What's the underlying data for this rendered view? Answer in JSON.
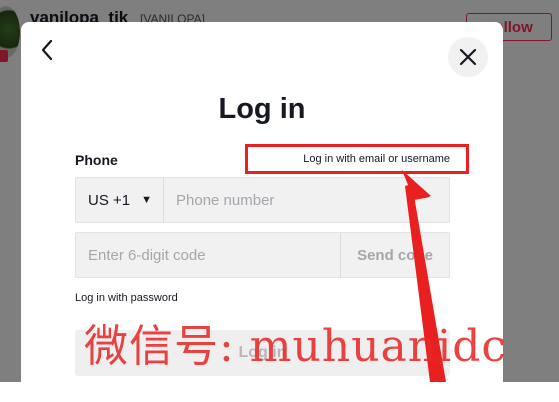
{
  "background": {
    "username": "vanilopa_tik",
    "nickname": "[VANILOPA]",
    "follow_label": "Follow"
  },
  "modal": {
    "title": "Log in",
    "phone_label": "Phone",
    "email_link": "Log in with email or username",
    "country_code": "US +1",
    "phone_placeholder": "Phone number",
    "code_placeholder": "Enter 6-digit code",
    "send_code_label": "Send code",
    "password_link": "Log in with password",
    "login_label": "Log in"
  },
  "icons": {
    "back": "chevron-left-icon",
    "close": "close-icon",
    "caret": "caret-down-icon"
  },
  "annotation": {
    "color": "#e8201f"
  },
  "watermark": {
    "text": "微信号: muhuanidc"
  }
}
